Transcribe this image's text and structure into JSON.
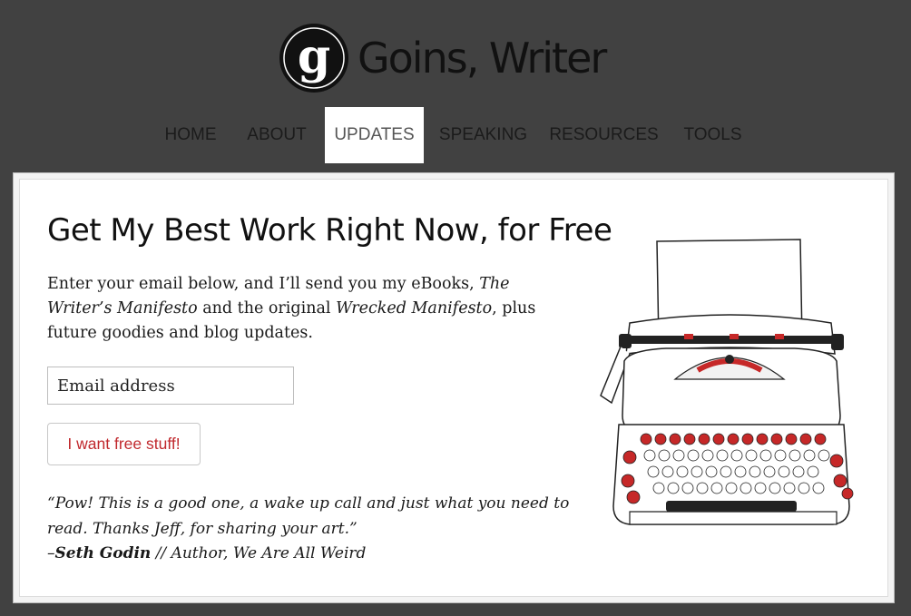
{
  "site": {
    "logo_letter": "g",
    "logo_text": "Goins, Writer"
  },
  "nav": {
    "items": [
      {
        "label": "HOME",
        "active": false
      },
      {
        "label": "ABOUT",
        "active": false
      },
      {
        "label": "UPDATES",
        "active": true
      },
      {
        "label": "SPEAKING",
        "active": false
      },
      {
        "label": "RESOURCES",
        "active": false
      },
      {
        "label": "TOOLS",
        "active": false
      }
    ]
  },
  "optin": {
    "headline": "Get My Best Work Right Now, for Free",
    "intro_pre": "Enter your email below, and I’ll send you my eBooks, ",
    "intro_book1": "The Writer’s Manifesto",
    "intro_mid": " and the original ",
    "intro_book2": "Wrecked Manifesto",
    "intro_post": ", plus future goodies and blog updates.",
    "email_placeholder": "Email address",
    "cta_label": "I want free stuff!",
    "quote_text": "“Pow! This is a good one, a wake up call and just what you need to read. Thanks Jeff, for sharing your art.”",
    "quote_dash": "–",
    "quote_author": "Seth Godin",
    "quote_role": " // Author, We Are All Weird"
  },
  "colors": {
    "background": "#414141",
    "accent_red": "#c0282d",
    "active_tab": "#ffffff"
  }
}
